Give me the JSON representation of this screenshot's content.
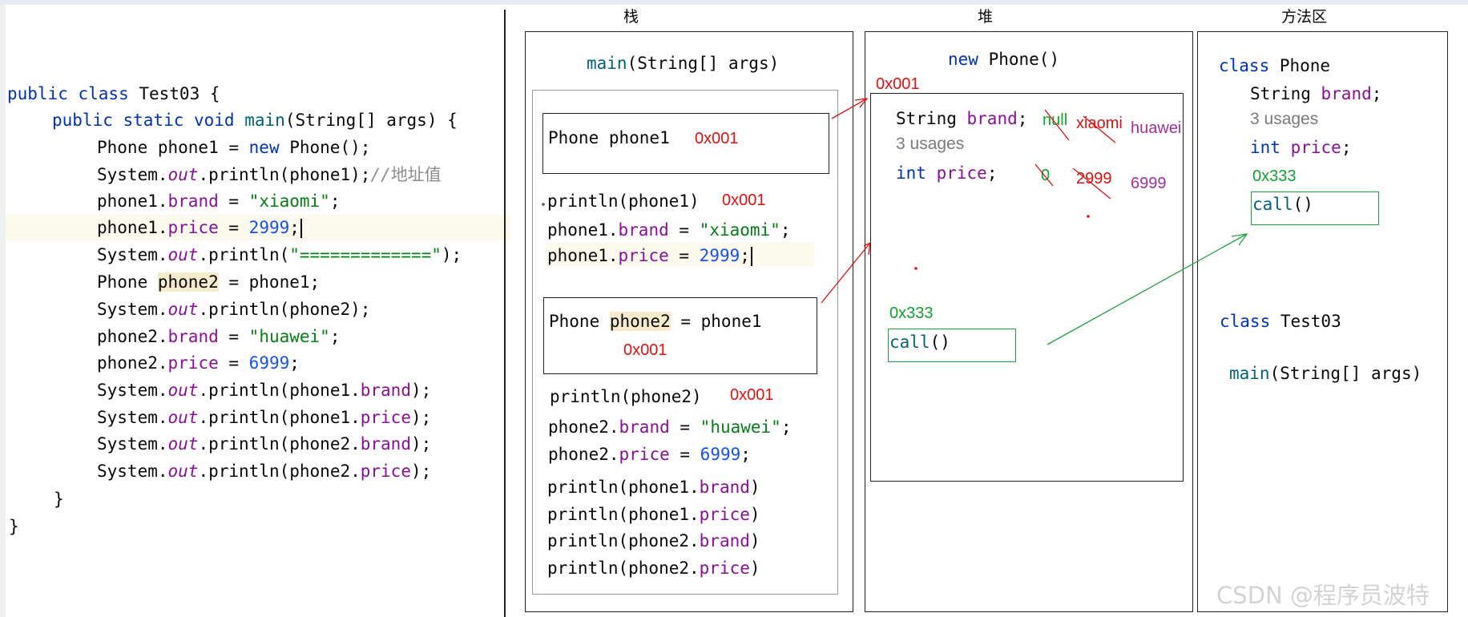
{
  "code": {
    "l1": {
      "kw": "public class",
      "rest": " Test03 {"
    },
    "l2": {
      "kw": "public static void",
      "fn": "main",
      "rest": "(String[] args) {"
    },
    "l3": {
      "a": "Phone phone1 = ",
      "kw": "new",
      "b": " Phone();"
    },
    "l4": {
      "a": "System.",
      "out": "out",
      "b": ".println(phone1);",
      "cmt": "//",
      "cmt_cn": "地址值"
    },
    "l5": {
      "a": "phone1.",
      "fld": "brand",
      "b": " = ",
      "str": "\"xiaomi\"",
      "c": ";"
    },
    "l6": {
      "a": "phone1.",
      "fld": "price",
      "b": " = ",
      "num": "2999",
      "c": ";"
    },
    "l7": {
      "a": "System.",
      "out": "out",
      "b": ".println(",
      "str": "\"=============\"",
      "c": ");"
    },
    "l8": {
      "a": "Phone ",
      "hl": "phone2",
      "b": " = phone1;"
    },
    "l9": {
      "a": "System.",
      "out": "out",
      "b": ".println(phone2);"
    },
    "l10": {
      "a": "phone2.",
      "fld": "brand",
      "b": " = ",
      "str": "\"huawei\"",
      "c": ";"
    },
    "l11": {
      "a": "phone2.",
      "fld": "price",
      "b": " = ",
      "num": "6999",
      "c": ";"
    },
    "l12": {
      "a": "System.",
      "out": "out",
      "b": ".println(phone1.",
      "fld": "brand",
      "c": ");"
    },
    "l13": {
      "a": "System.",
      "out": "out",
      "b": ".println(phone1.",
      "fld": "price",
      "c": ");"
    },
    "l14": {
      "a": "System.",
      "out": "out",
      "b": ".println(phone2.",
      "fld": "brand",
      "c": ");"
    },
    "l15": {
      "a": "System.",
      "out": "out",
      "b": ".println(phone2.",
      "fld": "price",
      "c": ");"
    },
    "close1": "}",
    "close2": "}"
  },
  "stack": {
    "title": "栈",
    "frame_fn": "main",
    "frame_rest": "(String[] args)",
    "phone1_decl": "Phone phone1",
    "phone1_addr": "0x001",
    "println1": "println(phone1)",
    "println1_addr": "0x001",
    "s_brand1": {
      "a": "phone1.",
      "fld": "brand",
      "b": " = ",
      "str": "\"xiaomi\"",
      "c": ";"
    },
    "s_price1": {
      "a": "phone1.",
      "fld": "price",
      "b": " = ",
      "num": "2999",
      "c": ";"
    },
    "phone2_a": "Phone ",
    "phone2_hl": "phone2",
    "phone2_b": " = phone1",
    "phone2_addr": "0x001",
    "println2": "println(phone2)",
    "println2_addr": "0x001",
    "s_brand2": {
      "a": "phone2.",
      "fld": "brand",
      "b": " = ",
      "str": "\"huawei\"",
      "c": ";"
    },
    "s_price2": {
      "a": "phone2.",
      "fld": "price",
      "b": " = ",
      "num": "6999",
      "c": ";"
    },
    "p1": {
      "a": "println(phone1.",
      "fld": "brand",
      "c": ")"
    },
    "p2": {
      "a": "println(phone1.",
      "fld": "price",
      "c": ")"
    },
    "p3": {
      "a": "println(phone2.",
      "fld": "brand",
      "c": ")"
    },
    "p4": {
      "a": "println(phone2.",
      "fld": "price",
      "c": ")"
    }
  },
  "heap": {
    "title": "堆",
    "new_kw": "new",
    "new_rest": " Phone()",
    "addr": "0x001",
    "brand_a": "String ",
    "brand_fld": "brand",
    "brand_c": ";",
    "usages": "3 usages",
    "price_kw": "int",
    "price_fld": "price",
    "price_c": ";",
    "v_null": "null",
    "v_xiaomi": "xiaomi",
    "v_huawei": "huawei",
    "v_zero": "0",
    "v_2999": "2999",
    "v_6999": "6999",
    "call_addr": "0x333",
    "call_fn": "call",
    "call_paren": "()"
  },
  "method_area": {
    "title": "方法区",
    "class_kw": "class",
    "class_name": " Phone",
    "brand_a": "String ",
    "brand_fld": "brand",
    "brand_c": ";",
    "usages": "3 usages",
    "price_kw": "int",
    "price_fld": "price",
    "price_c": ";",
    "call_addr": "0x333",
    "call_fn": "call",
    "call_paren": "()",
    "class2_kw": "class",
    "class2_name": " Test03",
    "main_fn": "main",
    "main_rest": "(String[] args)"
  },
  "watermark": "CSDN @程序员波特",
  "colors": {
    "keyword": "#0033b3",
    "field": "#871094",
    "string": "#067d17",
    "number": "#1750eb",
    "annotation_red": "#e01010",
    "annotation_green": "#12a030",
    "annotation_purple": "#a030a0"
  }
}
